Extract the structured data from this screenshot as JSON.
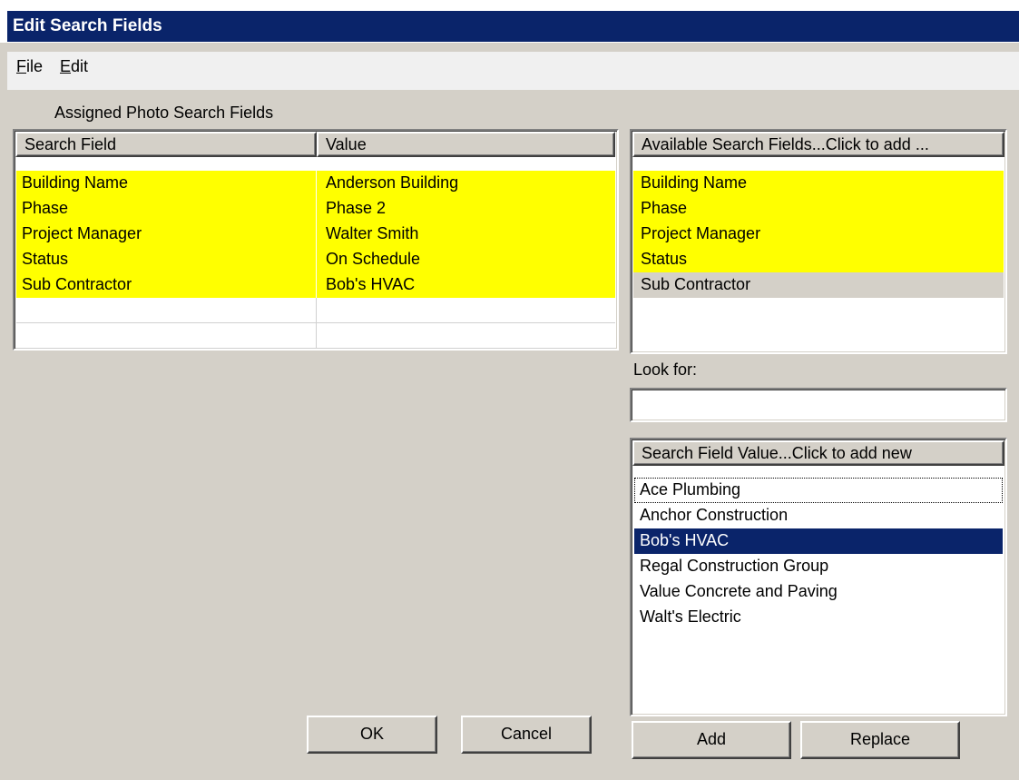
{
  "window": {
    "title": "Edit Search Fields"
  },
  "menu": [
    {
      "key": "F",
      "rest": "ile"
    },
    {
      "key": "E",
      "rest": "dit"
    }
  ],
  "assigned": {
    "label": "Assigned Photo Search Fields",
    "headers": {
      "field": "Search Field",
      "value": "Value"
    },
    "rows": [
      {
        "field": "Building Name",
        "value": "Anderson Building"
      },
      {
        "field": "Phase",
        "value": "Phase 2"
      },
      {
        "field": "Project Manager",
        "value": "Walter Smith"
      },
      {
        "field": "Status",
        "value": "On Schedule"
      },
      {
        "field": "Sub Contractor",
        "value": "Bob's HVAC"
      },
      {
        "field": "",
        "value": ""
      },
      {
        "field": "",
        "value": ""
      }
    ]
  },
  "available": {
    "header": "Available Search Fields...Click to add ...",
    "items": [
      "Building Name",
      "Phase",
      "Project Manager",
      "Status",
      "Sub Contractor"
    ]
  },
  "lookfor": {
    "label": "Look for:",
    "value": ""
  },
  "values": {
    "header": "Search Field Value...Click to add new",
    "items": [
      "Ace Plumbing",
      "Anchor Construction",
      "Bob's HVAC",
      "Regal Construction Group",
      "Value Concrete and Paving",
      "Walt's Electric"
    ],
    "selected": "Bob's HVAC"
  },
  "buttons": {
    "ok": "OK",
    "cancel": "Cancel",
    "add": "Add",
    "replace": "Replace"
  },
  "colors": {
    "highlight": "#ffff00",
    "selection": "#0a246a",
    "face": "#d4d0c8"
  }
}
